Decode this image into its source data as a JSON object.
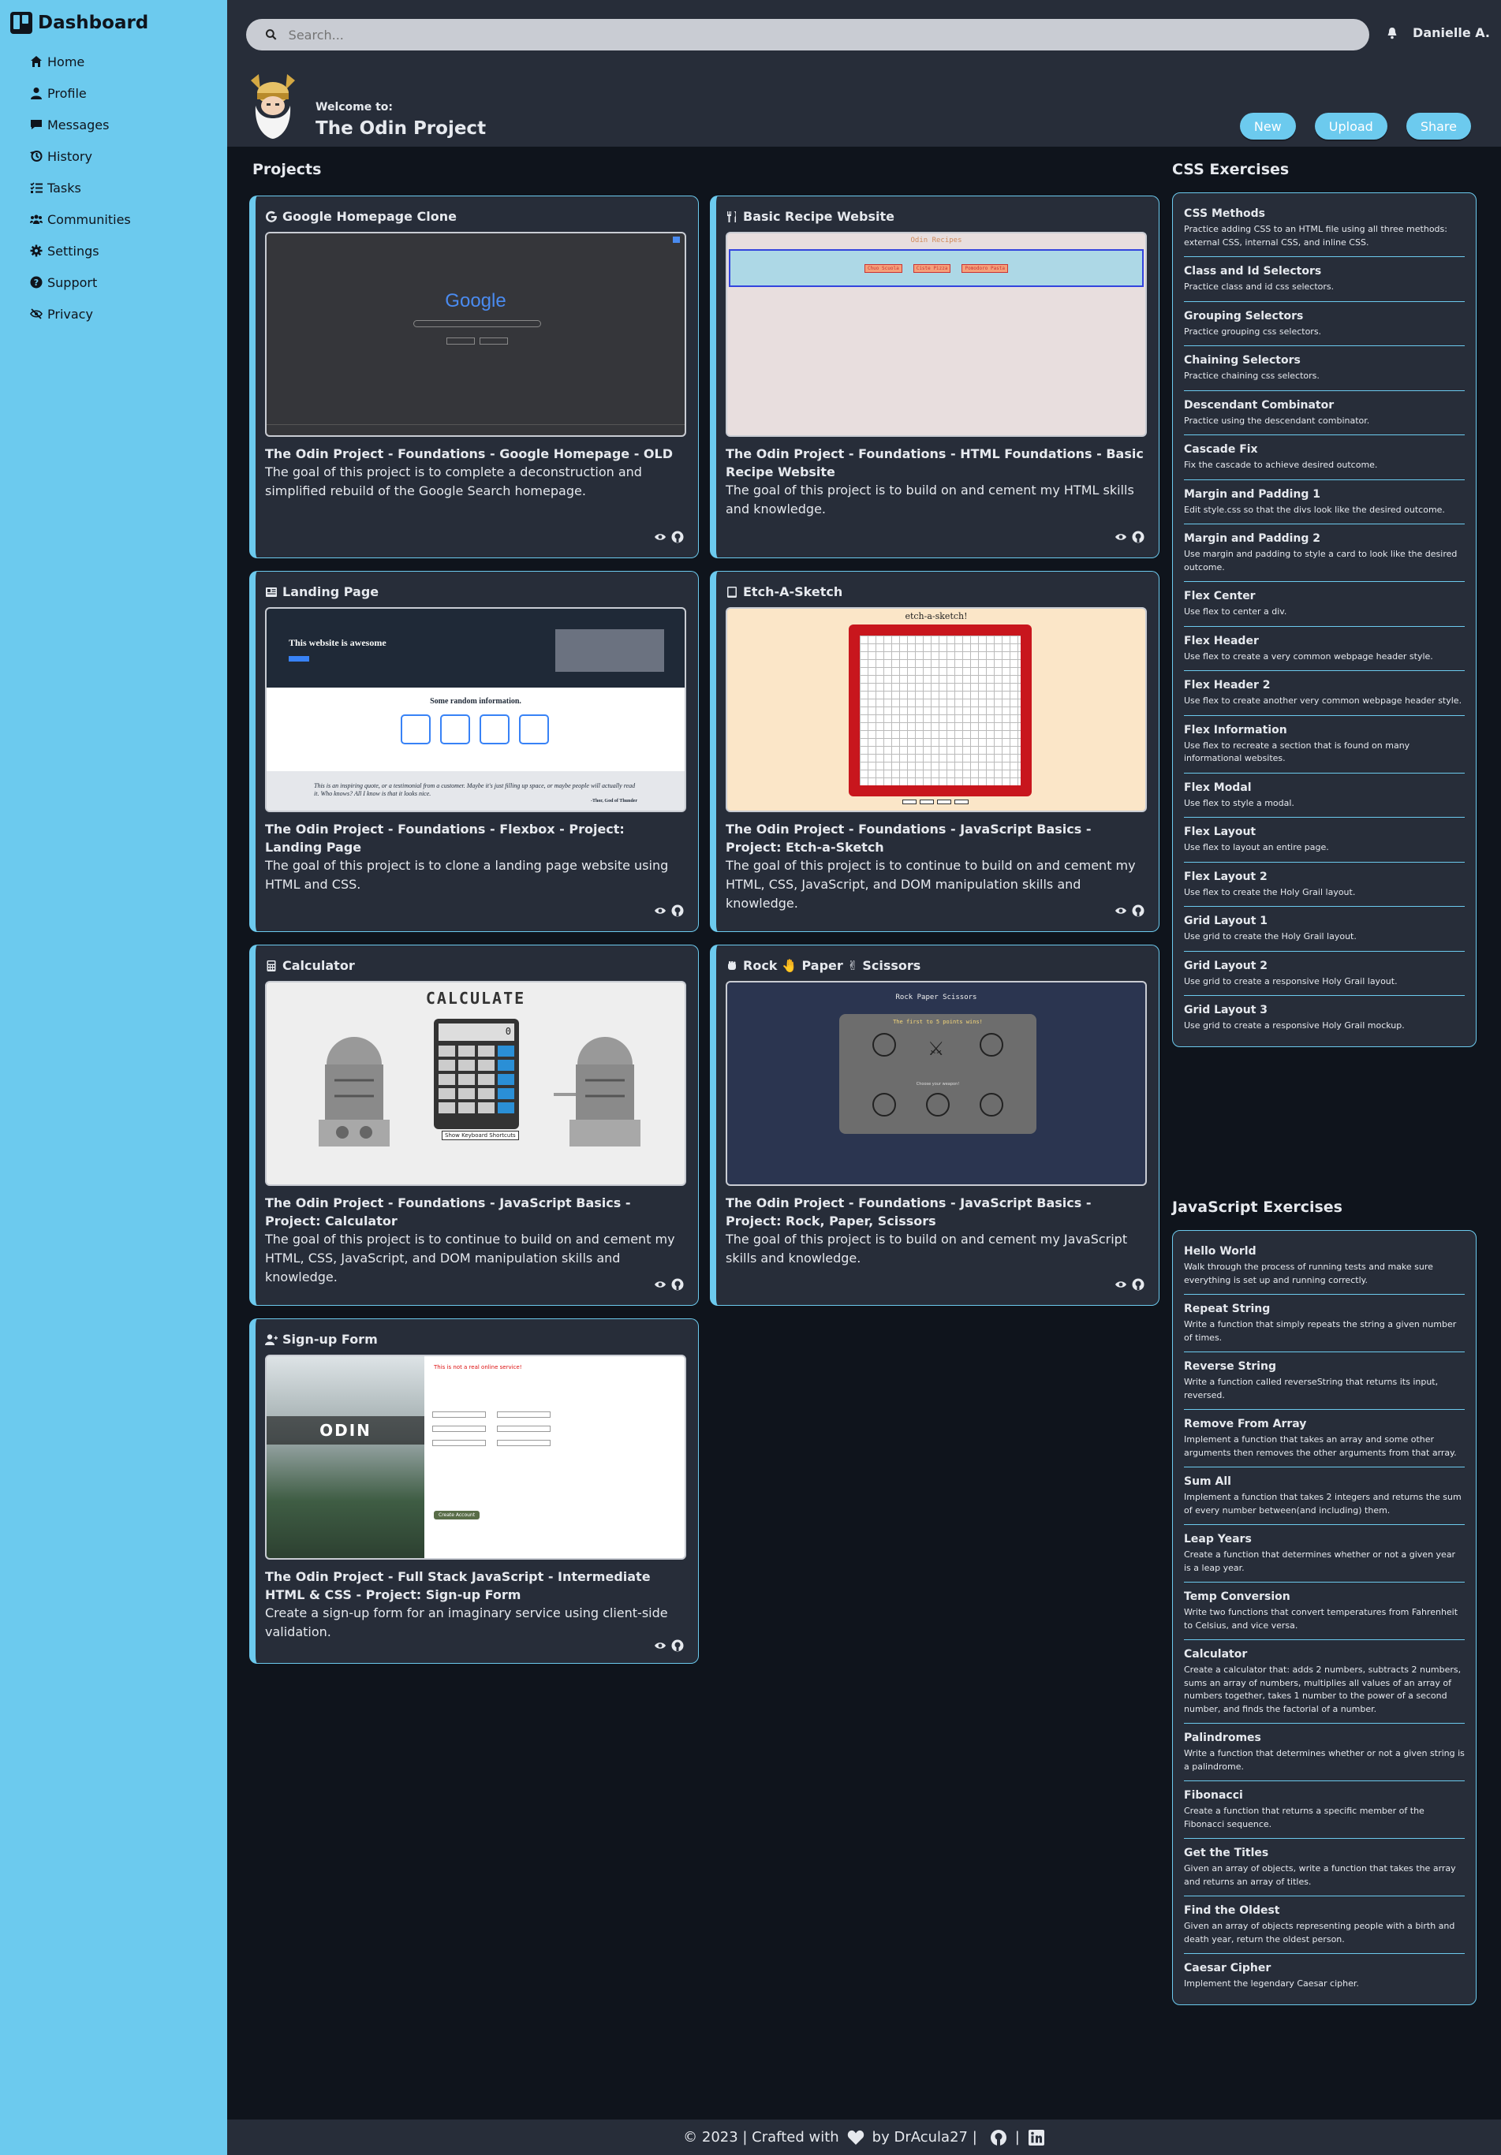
{
  "sidebar": {
    "brand": "Dashboard",
    "items": [
      {
        "label": "Home",
        "icon": "home-icon"
      },
      {
        "label": "Profile",
        "icon": "user-icon"
      },
      {
        "label": "Messages",
        "icon": "message-icon"
      },
      {
        "label": "History",
        "icon": "history-icon"
      },
      {
        "label": "Tasks",
        "icon": "tasks-icon"
      },
      {
        "label": "Communities",
        "icon": "communities-icon"
      },
      {
        "label": "Settings",
        "icon": "gear-icon"
      },
      {
        "label": "Support",
        "icon": "help-icon"
      },
      {
        "label": "Privacy",
        "icon": "eye-slash-icon"
      }
    ]
  },
  "header": {
    "search_placeholder": "Search...",
    "user_name": "Danielle A.",
    "welcome_label": "Welcome to:",
    "welcome_title": "The Odin Project",
    "buttons": [
      "New",
      "Upload",
      "Share"
    ]
  },
  "main": {
    "projects_title": "Projects",
    "projects": [
      {
        "title": "Google Homepage Clone",
        "name": "The Odin Project - Foundations - Google Homepage - OLD",
        "desc": "The goal of this project is to complete a deconstruction and simplified rebuild of the Google Search homepage."
      },
      {
        "title": "Basic Recipe Website",
        "name": "The Odin Project - Foundations - HTML Foundations - Basic Recipe Website",
        "desc": "The goal of this project is to build on and cement my HTML skills and knowledge."
      },
      {
        "title": "Landing Page",
        "name": "The Odin Project - Foundations - Flexbox - Project: Landing Page",
        "desc": "The goal of this project is to clone a landing page website using HTML and CSS."
      },
      {
        "title": "Etch-A-Sketch",
        "name": "The Odin Project - Foundations - JavaScript Basics - Project: Etch-a-Sketch",
        "desc": "The goal of this project is to continue to build on and cement my HTML, CSS, JavaScript, and DOM manipulation skills and knowledge."
      },
      {
        "title": "Calculator",
        "name": "The Odin Project - Foundations - JavaScript Basics - Project: Calculator",
        "desc": "The goal of this project is to continue to build on and cement my HTML, CSS, JavaScript, and DOM manipulation skills and knowledge."
      },
      {
        "title": "Rock 🤚 Paper ✌ Scissors",
        "name": "The Odin Project - Foundations - JavaScript Basics - Project: Rock, Paper, Scissors",
        "desc": "The goal of this project is to build on and cement my JavaScript skills and knowledge."
      },
      {
        "title": "Sign-up Form",
        "name": "The Odin Project - Full Stack JavaScript - Intermediate HTML & CSS - Project: Sign-up Form",
        "desc": "Create a sign-up form for an imaginary service using client-side validation."
      }
    ],
    "previews": {
      "google_logo": "Google",
      "recipe_heading": "Odin Recipes",
      "recipe_links": [
        "Chuo Scuola",
        "Ciste Pizza",
        "Pomodoro Pasta"
      ],
      "landing_hero": "This website is awesome",
      "landing_info": "Some random information.",
      "landing_quote": "This is an inspiring quote, or a testimonial from a customer. Maybe it's just filling up space, or maybe people will actually read it. Who knows? All I know is that it looks nice.",
      "landing_quote_author": "-Thor, God of Thunder",
      "etch_title": "etch-a-sketch!",
      "calc_title": "CALCULATE",
      "calc_display": "0",
      "calc_shortcuts": "Show Keyboard Shortcuts",
      "rps_title": "Rock Paper Scissors",
      "rps_sub": "The first to 5 points wins!",
      "rps_choose": "Choose your weapon!",
      "signup_brand": "ODIN",
      "signup_notice": "This is not a real online service!",
      "signup_button": "Create Account"
    }
  },
  "css_exercises": {
    "title": "CSS Exercises",
    "items": [
      {
        "t": "CSS Methods",
        "d": "Practice adding CSS to an HTML file using all three methods: external CSS, internal CSS, and inline CSS."
      },
      {
        "t": "Class and Id Selectors",
        "d": "Practice class and id css selectors."
      },
      {
        "t": "Grouping Selectors",
        "d": "Practice grouping css selectors."
      },
      {
        "t": "Chaining Selectors",
        "d": "Practice chaining css selectors."
      },
      {
        "t": "Descendant Combinator",
        "d": "Practice using the descendant combinator."
      },
      {
        "t": "Cascade Fix",
        "d": "Fix the cascade to achieve desired outcome."
      },
      {
        "t": "Margin and Padding 1",
        "d": "Edit style.css so that the divs look like the desired outcome."
      },
      {
        "t": "Margin and Padding 2",
        "d": "Use margin and padding to style a card to look like the desired outcome."
      },
      {
        "t": "Flex Center",
        "d": "Use flex to center a div."
      },
      {
        "t": "Flex Header",
        "d": "Use flex to create a very common webpage header style."
      },
      {
        "t": "Flex Header 2",
        "d": "Use flex to create another very common webpage header style."
      },
      {
        "t": "Flex Information",
        "d": "Use flex to recreate a section that is found on many informational websites."
      },
      {
        "t": "Flex Modal",
        "d": "Use flex to style a modal."
      },
      {
        "t": "Flex Layout",
        "d": "Use flex to layout an entire page."
      },
      {
        "t": "Flex Layout 2",
        "d": "Use flex to create the Holy Grail layout."
      },
      {
        "t": "Grid Layout 1",
        "d": "Use grid to create the Holy Grail layout."
      },
      {
        "t": "Grid Layout 2",
        "d": "Use grid to create a responsive Holy Grail layout."
      },
      {
        "t": "Grid Layout 3",
        "d": "Use grid to create a responsive Holy Grail mockup."
      }
    ]
  },
  "js_exercises": {
    "title": "JavaScript Exercises",
    "items": [
      {
        "t": "Hello World",
        "d": "Walk through the process of running tests and make sure everything is set up and running correctly."
      },
      {
        "t": "Repeat String",
        "d": "Write a function that simply repeats the string a given number of times."
      },
      {
        "t": "Reverse String",
        "d": "Write a function called reverseString that returns its input, reversed."
      },
      {
        "t": "Remove From Array",
        "d": "Implement a function that takes an array and some other arguments then removes the other arguments from that array."
      },
      {
        "t": "Sum All",
        "d": "Implement a function that takes 2 integers and returns the sum of every number between(and including) them."
      },
      {
        "t": "Leap Years",
        "d": "Create a function that determines whether or not a given year is a leap year."
      },
      {
        "t": "Temp Conversion",
        "d": "Write two functions that convert temperatures from Fahrenheit to Celsius, and vice versa."
      },
      {
        "t": "Calculator",
        "d": "Create a calculator that: adds 2 numbers, subtracts 2 numbers, sums an array of numbers, multiplies all values of an array of numbers together, takes 1 number to the power of a second number, and finds the factorial of a number."
      },
      {
        "t": "Palindromes",
        "d": "Write a function that determines whether or not a given string is a palindrome."
      },
      {
        "t": "Fibonacci",
        "d": "Create a function that returns a specific member of the Fibonacci sequence."
      },
      {
        "t": "Get the Titles",
        "d": "Given an array of objects, write a function that takes the array and returns an array of titles."
      },
      {
        "t": "Find the Oldest",
        "d": "Given an array of objects representing people with a birth and death year, return the oldest person."
      },
      {
        "t": "Caesar Cipher",
        "d": "Implement the legendary Caesar cipher."
      }
    ]
  },
  "footer": {
    "text": "© 2023 | Crafted with",
    "by": "by DrAcula27 |",
    "sep": "|"
  },
  "colors": {
    "accent": "#6ccaee",
    "panel": "#272d39",
    "bg": "#0f141c"
  }
}
